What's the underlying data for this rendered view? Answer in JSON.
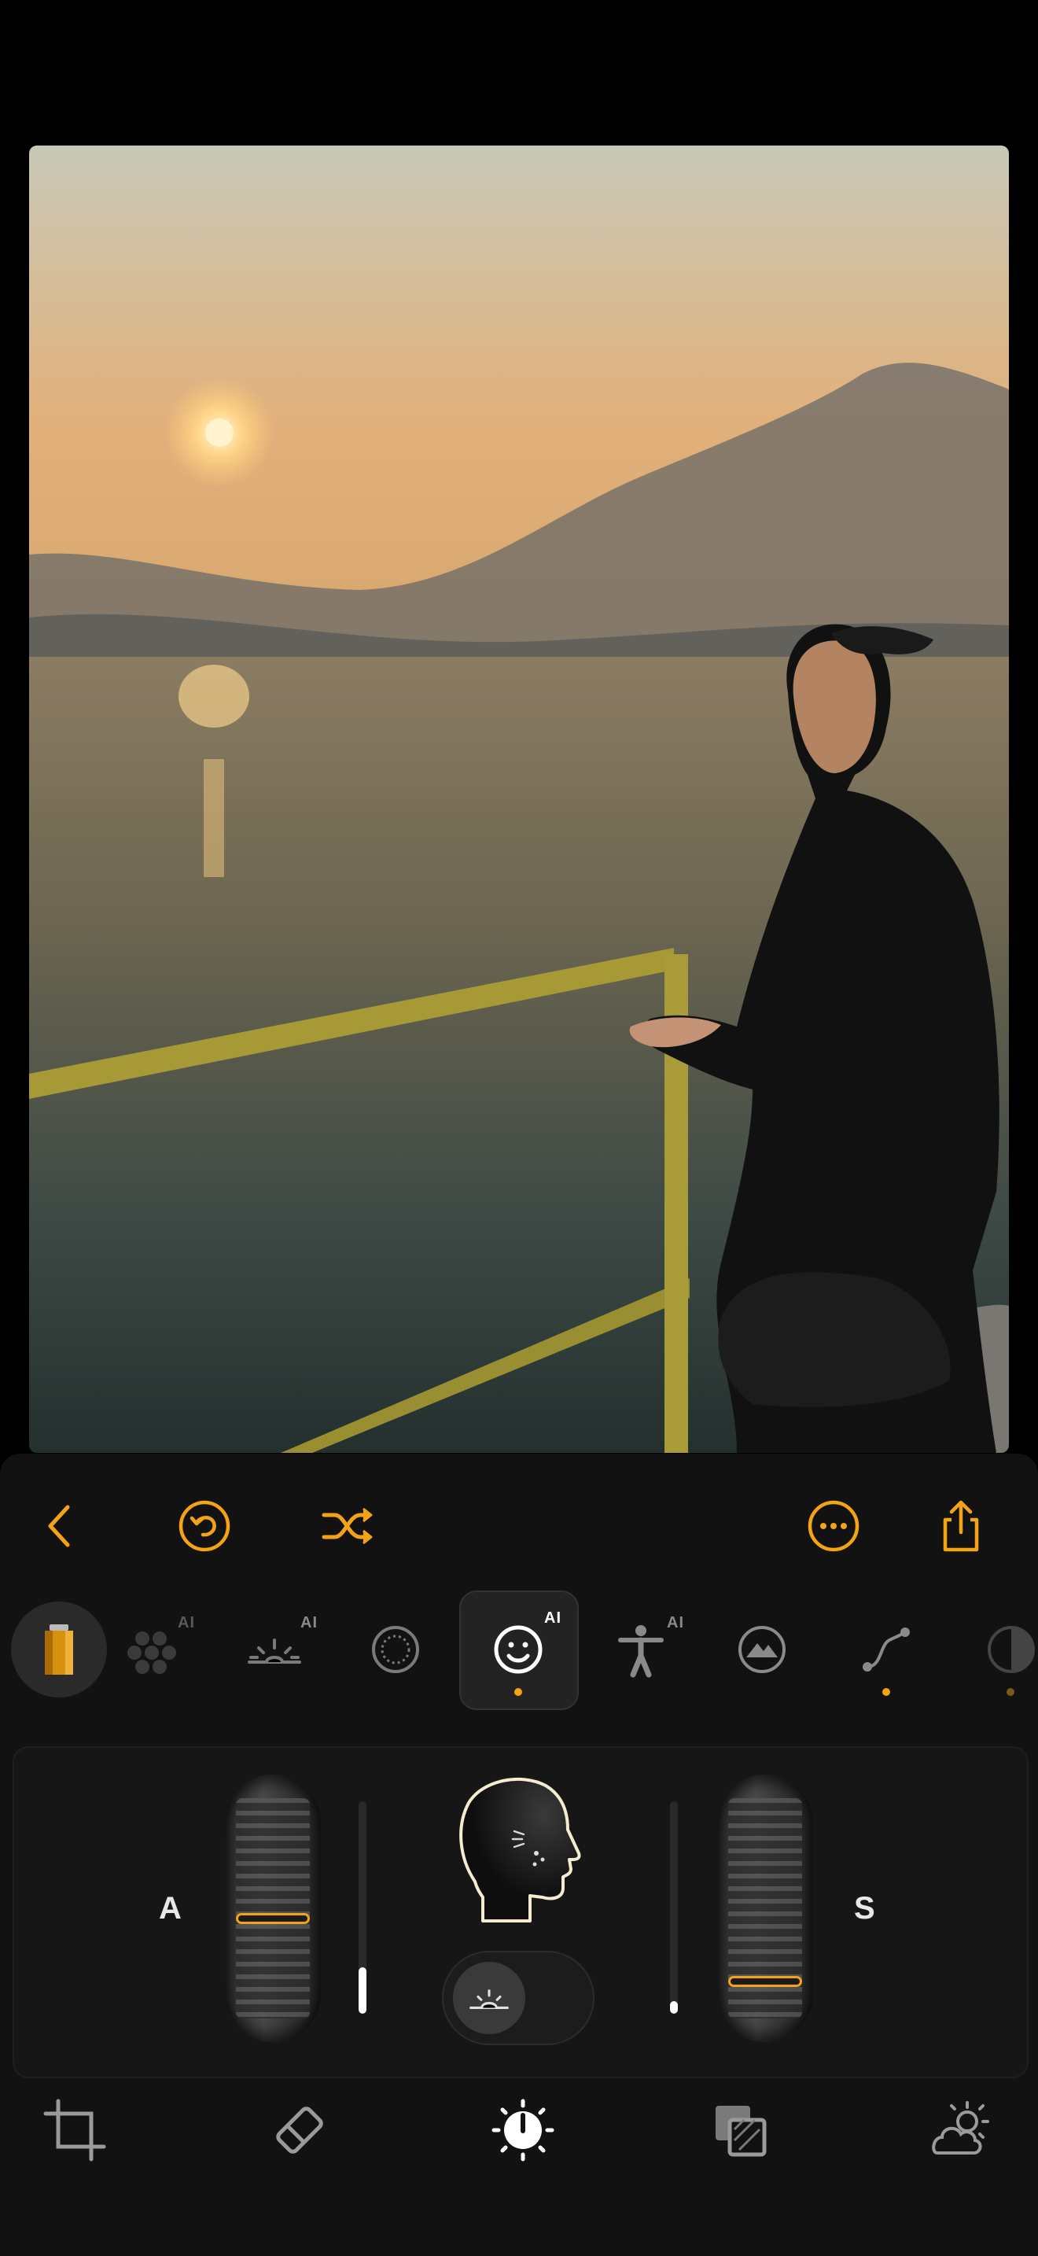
{
  "toolbar": {
    "back_icon": "chevron-left-icon",
    "undo_icon": "undo-icon",
    "shuffle_icon": "shuffle-icon",
    "more_icon": "ellipsis-circle-icon",
    "share_icon": "share-icon"
  },
  "tools": [
    {
      "icon": "film-roll-icon",
      "ai": "",
      "selected": false
    },
    {
      "icon": "grain-icon",
      "ai": "AI",
      "selected": false
    },
    {
      "icon": "sunrise-icon",
      "ai": "AI",
      "selected": false
    },
    {
      "icon": "vignette-icon",
      "ai": "",
      "selected": false
    },
    {
      "icon": "face-icon",
      "ai": "AI",
      "selected": true,
      "dot": true
    },
    {
      "icon": "person-icon",
      "ai": "AI",
      "selected": false
    },
    {
      "icon": "landscape-icon",
      "ai": "",
      "selected": false
    },
    {
      "icon": "curve-icon",
      "ai": "",
      "selected": false,
      "dot": true
    },
    {
      "icon": "half-circle-icon",
      "ai": "",
      "selected": false,
      "dot": true
    }
  ],
  "adjust": {
    "left_label": "A",
    "right_label": "S",
    "left_level": 0.22,
    "right_level": 0.06
  },
  "bottom_nav": [
    "crop-icon",
    "eraser-icon",
    "adjust-dial-icon",
    "layers-icon",
    "weather-icon"
  ],
  "colors": {
    "accent": "#f5a316",
    "panel": "#121212"
  }
}
